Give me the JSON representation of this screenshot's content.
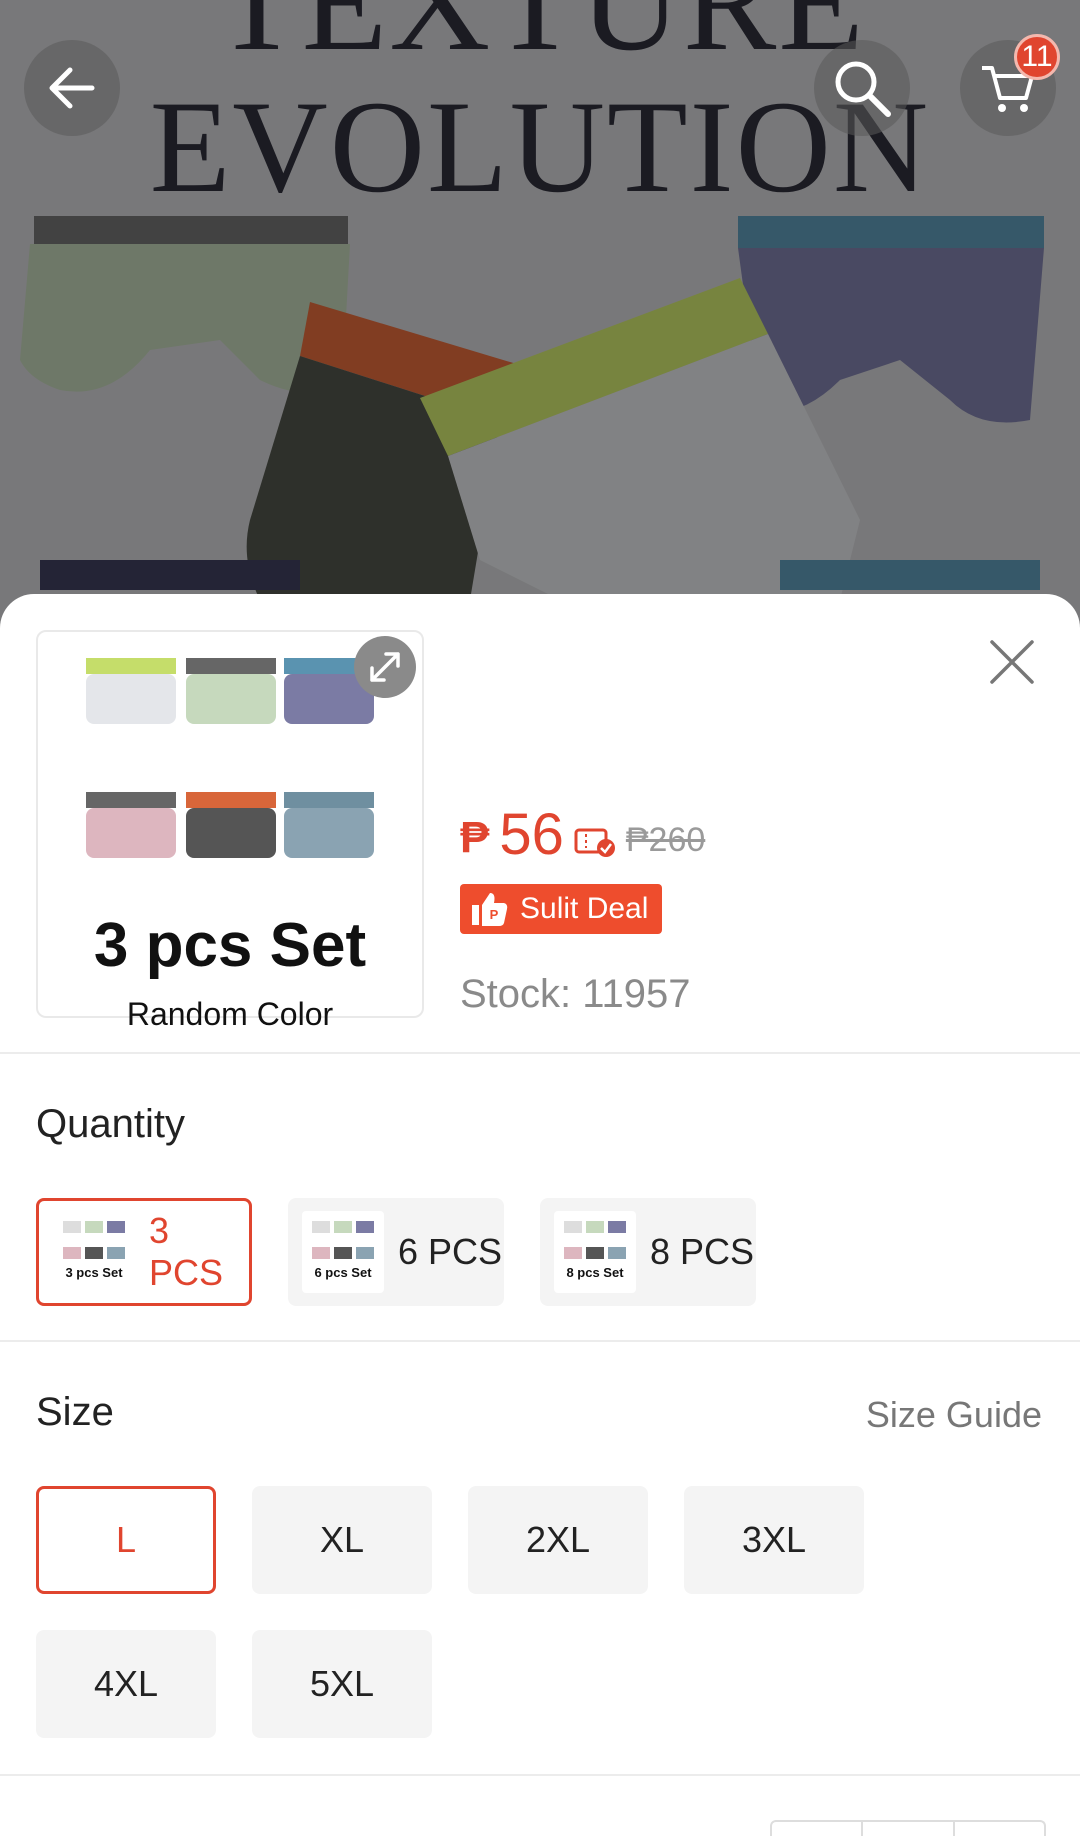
{
  "hero": {
    "title_line1": "TEXTURE",
    "title_line2": "EVOLUTION",
    "cart_count": "11"
  },
  "icons": {
    "back": "arrow-left-icon",
    "search": "search-icon",
    "cart": "cart-icon",
    "expand": "expand-icon",
    "close": "close-icon",
    "voucher": "voucher-icon",
    "deal": "thumbs-up-icon"
  },
  "product": {
    "thumb_title": "3 pcs Set",
    "thumb_subtitle": "Random Color",
    "currency": "₱",
    "price": "56",
    "original_price": "₱260",
    "deal_label": "Sulit Deal",
    "stock": "Stock: 11957"
  },
  "quantity": {
    "label": "Quantity",
    "options": [
      {
        "label": "3 PCS",
        "img_caption": "3 pcs Set",
        "selected": true
      },
      {
        "label": "6 PCS",
        "img_caption": "6 pcs Set",
        "selected": false
      },
      {
        "label": "8 PCS",
        "img_caption": "8 pcs Set",
        "selected": false
      }
    ]
  },
  "size": {
    "label": "Size",
    "guide_label": "Size Guide",
    "options": [
      "L",
      "XL",
      "2XL",
      "3XL",
      "4XL",
      "5XL"
    ],
    "selected": "L"
  },
  "colors": {
    "accent": "#e0452f",
    "deal_bg": "#ee4d2d"
  }
}
